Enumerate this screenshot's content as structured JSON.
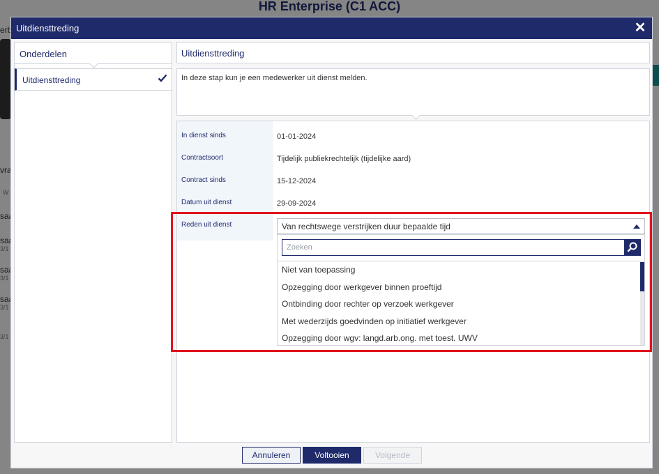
{
  "background": {
    "app_title": "HR Enterprise (C1 ACC)",
    "fragments": [
      "erb",
      "vra",
      "saa",
      "saa",
      "saa",
      "saa"
    ],
    "small_fragments": [
      "W",
      "3/1",
      "3/1",
      "3/1",
      "3/1"
    ]
  },
  "modal": {
    "title": "Uitdiensttreding",
    "left_panel": {
      "heading": "Onderdelen",
      "items": [
        {
          "label": "Uitdiensttreding",
          "completed": true
        }
      ]
    },
    "section_title": "Uitdiensttreding",
    "intro_text": "In deze stap kun je een medewerker uit dienst melden.",
    "fields": [
      {
        "label": "In dienst sinds",
        "value": "01-01-2024"
      },
      {
        "label": "Contractsoort",
        "value": "Tijdelijk publiekrechtelijk (tijdelijke aard)"
      },
      {
        "label": "Contract sinds",
        "value": "15-12-2024"
      },
      {
        "label": "Datum uit dienst",
        "value": "29-09-2024"
      }
    ],
    "reason": {
      "label": "Reden uit dienst",
      "selected": "Van rechtswege verstrijken duur bepaalde tijd",
      "search_placeholder": "Zoeken",
      "options": [
        "Niet van toepassing",
        "Opzegging door werkgever binnen proeftijd",
        "Ontbinding door rechter op verzoek werkgever",
        "Met wederzijds goedvinden op initiatief werkgever",
        "Opzegging door wgv: langd.arb.ong. met toest. UWV"
      ]
    },
    "buttons": {
      "cancel": "Annuleren",
      "finish": "Voltooien",
      "next": "Volgende"
    }
  },
  "colors": {
    "primary": "#1f2a6b",
    "highlight": "#e0141e",
    "label_bg": "#f1f6fb"
  }
}
